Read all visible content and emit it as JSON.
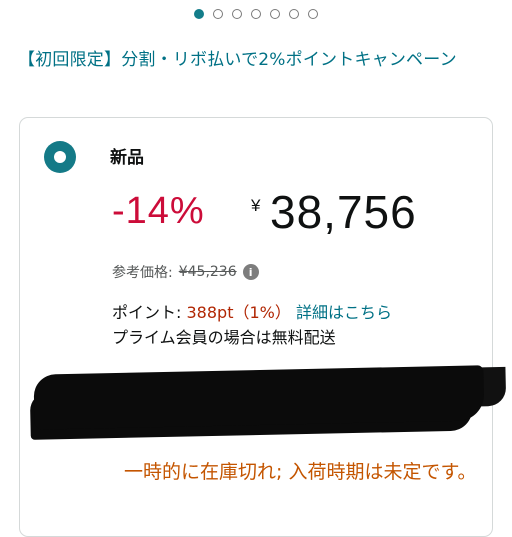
{
  "carousel": {
    "total_dots": 7,
    "active_index": 0,
    "active_color": "#137d8a"
  },
  "promo": {
    "text": "【初回限定】分割・リボ払いで2%ポイントキャンペーン"
  },
  "offer": {
    "condition": "新品",
    "discount": "-14%",
    "currency_symbol": "¥",
    "price": "38,756",
    "reference_label": "参考価格:",
    "reference_price": "¥45,236",
    "points_label": "ポイント:",
    "points_value": "388pt（1%）",
    "points_link": "詳細はこちら",
    "shipping_note": "プライム会員の場合は無料配送",
    "stock_status": "一時的に在庫切れ; 入荷時期は未定です。"
  },
  "colors": {
    "discount": "#cc0c39",
    "link": "#007185",
    "points": "#b12704",
    "stock": "#c45500",
    "radio": "#147a87"
  },
  "icons": {
    "info": "info-icon",
    "radio": "radio-selected-icon"
  }
}
